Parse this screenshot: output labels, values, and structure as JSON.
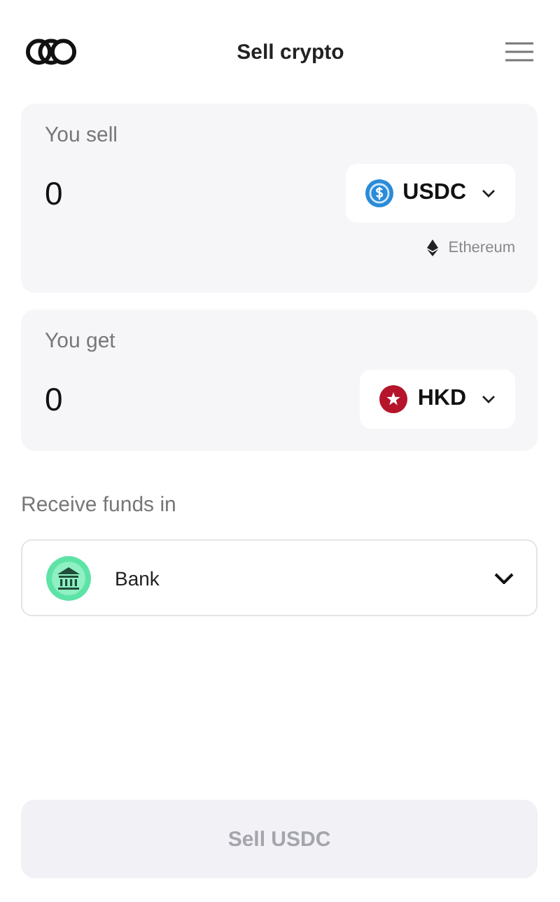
{
  "header": {
    "title": "Sell crypto"
  },
  "sell": {
    "label": "You sell",
    "amount": "0",
    "currency": {
      "code": "USDC",
      "kind": "usdc"
    },
    "network": {
      "name": "Ethereum",
      "kind": "eth"
    }
  },
  "get": {
    "label": "You get",
    "amount": "0",
    "currency": {
      "code": "HKD",
      "kind": "hkd"
    }
  },
  "receive": {
    "label": "Receive funds in",
    "method": {
      "name": "Bank",
      "kind": "bank"
    }
  },
  "submit": {
    "label": "Sell USDC",
    "disabled": true
  }
}
